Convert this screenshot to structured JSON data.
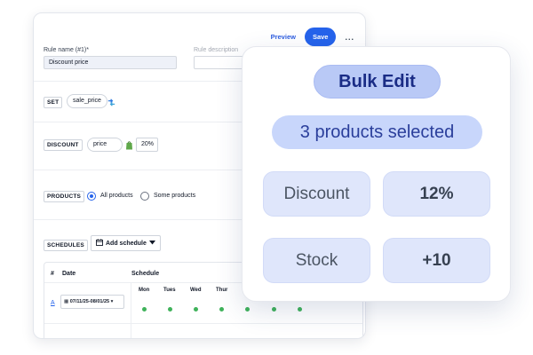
{
  "editor": {
    "preview_label": "Preview",
    "save_label": "Save",
    "more_label": "...",
    "rule_name_label": "Rule name (#1)*",
    "rule_name_value": "Discount price",
    "rule_description_label": "Rule description",
    "set_tag": "SET",
    "set_field": "sale_price",
    "discount_tag": "DISCOUNT",
    "discount_field": "price",
    "discount_value": "20%",
    "products_tag": "PRODUCTS",
    "products_options": [
      "All products",
      "Some products"
    ],
    "products_selected": "All products",
    "schedules_tag": "SCHEDULES",
    "add_schedule_label": "Add schedule",
    "table": {
      "col_hash": "#",
      "col_date": "Date",
      "col_schedule": "Schedule",
      "days": [
        "Mon",
        "Tues",
        "Wed",
        "Thur"
      ],
      "row_link": "A",
      "row_date": "07/11/25-08/01/25"
    }
  },
  "bulk_edit": {
    "title": "Bulk Edit",
    "subtitle": "3 products selected",
    "rows": [
      {
        "label": "Discount",
        "value": "12%"
      },
      {
        "label": "Stock",
        "value": "+10"
      }
    ]
  },
  "colors": {
    "accent": "#2563eb",
    "dot_green": "#3fb25a",
    "chip_blue": "#b9c9f6",
    "chip_light": "#dfe6fb"
  }
}
